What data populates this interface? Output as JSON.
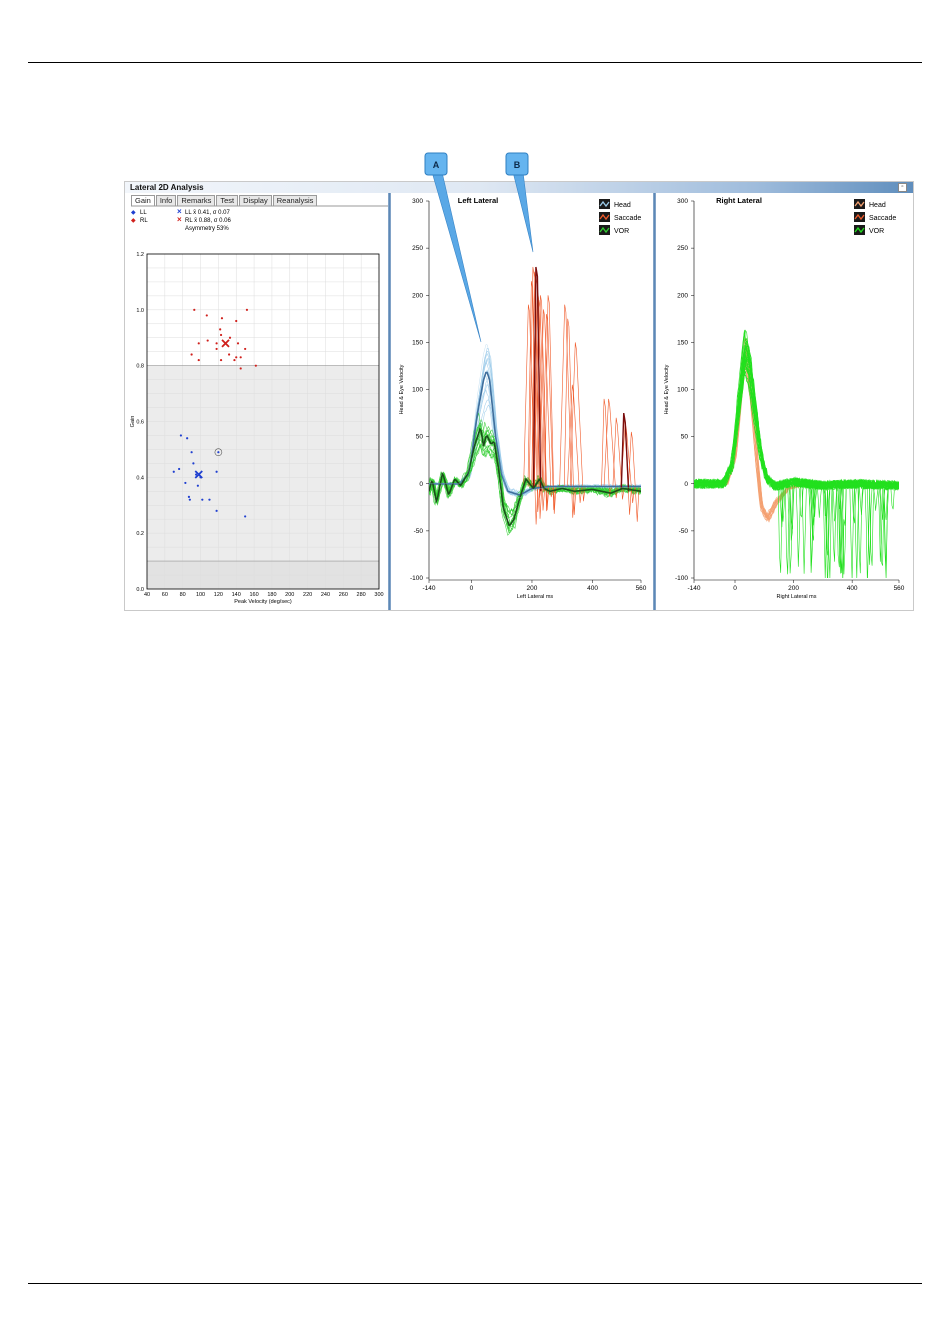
{
  "window": {
    "title": "Lateral 2D Analysis"
  },
  "tabs": [
    "Gain",
    "Info",
    "Remarks",
    "Test",
    "Display",
    "Reanalysis"
  ],
  "gain_panel": {
    "legend": [
      {
        "label": "LL",
        "color": "#1f3fd0"
      },
      {
        "label": "RL",
        "color": "#d0201c"
      }
    ],
    "stats": {
      "ll": "LL x̄ 0.41, σ 0.07",
      "rl": "RL x̄ 0.88, σ 0.06",
      "asymmetry": "Asymmetry 53%"
    }
  },
  "callouts": {
    "a": "A",
    "b": "B"
  },
  "chart_data": [
    {
      "type": "scatter",
      "xlabel": "Peak Velocity (deg/sec)",
      "ylabel": "Gain",
      "xlim": [
        40,
        300
      ],
      "ylim": [
        0,
        1.2
      ],
      "xticks": [
        40,
        60,
        80,
        100,
        120,
        140,
        160,
        180,
        200,
        220,
        240,
        260,
        280,
        300
      ],
      "yticks": [
        0.0,
        0.2,
        0.4,
        0.6,
        0.8,
        1.0,
        1.2
      ],
      "normal_band": [
        0.8,
        1.2
      ],
      "lower_band": [
        0.0,
        0.1
      ],
      "series": [
        {
          "name": "LL",
          "color": "#1f3fd0",
          "points": [
            [
              78,
              0.55
            ],
            [
              85,
              0.54
            ],
            [
              90,
              0.49
            ],
            [
              120,
              0.49
            ],
            [
              92,
              0.45
            ],
            [
              70,
              0.42
            ],
            [
              76,
              0.43
            ],
            [
              95,
              0.41
            ],
            [
              100,
              0.4
            ],
            [
              118,
              0.42
            ],
            [
              83,
              0.38
            ],
            [
              97,
              0.37
            ],
            [
              87,
              0.33
            ],
            [
              88,
              0.32
            ],
            [
              102,
              0.32
            ],
            [
              110,
              0.32
            ],
            [
              118,
              0.28
            ],
            [
              150,
              0.26
            ]
          ],
          "mean": [
            98,
            0.41
          ]
        },
        {
          "name": "RL",
          "color": "#d0201c",
          "points": [
            [
              93,
              1.0
            ],
            [
              107,
              0.98
            ],
            [
              152,
              1.0
            ],
            [
              124,
              0.97
            ],
            [
              140,
              0.96
            ],
            [
              122,
              0.93
            ],
            [
              123,
              0.91
            ],
            [
              133,
              0.9
            ],
            [
              108,
              0.89
            ],
            [
              98,
              0.88
            ],
            [
              142,
              0.88
            ],
            [
              118,
              0.86
            ],
            [
              150,
              0.86
            ],
            [
              90,
              0.84
            ],
            [
              132,
              0.84
            ],
            [
              140,
              0.83
            ],
            [
              145,
              0.83
            ],
            [
              98,
              0.82
            ],
            [
              123,
              0.82
            ],
            [
              138,
              0.82
            ],
            [
              162,
              0.8
            ],
            [
              145,
              0.79
            ],
            [
              118,
              0.88
            ]
          ],
          "mean": [
            128,
            0.88
          ]
        }
      ]
    },
    {
      "type": "line",
      "title": "Left Lateral",
      "xlabel": "Left Lateral ms",
      "ylabel": "Head & Eye Velocity",
      "xlim": [
        -140,
        560
      ],
      "ylim": [
        -100,
        300
      ],
      "xticks": [
        -140,
        0,
        200,
        400,
        560
      ],
      "yticks": [
        -100,
        -50,
        0,
        50,
        100,
        150,
        200,
        250,
        300
      ],
      "legend": [
        "Head",
        "Saccade",
        "VOR"
      ],
      "colors": {
        "head": "#9ccbea",
        "head_mean": "#3f6e9c",
        "saccade": "#f05a2a",
        "saccade_mean": "#7a0d0d",
        "vor": "#32cd32",
        "vor_mean": "#1b4f1b"
      },
      "head_mean": [
        [
          -140,
          0
        ],
        [
          -40,
          0
        ],
        [
          -10,
          10
        ],
        [
          0,
          28
        ],
        [
          20,
          75
        ],
        [
          40,
          110
        ],
        [
          50,
          120
        ],
        [
          60,
          110
        ],
        [
          80,
          50
        ],
        [
          100,
          10
        ],
        [
          120,
          -8
        ],
        [
          160,
          -12
        ],
        [
          200,
          -5
        ],
        [
          260,
          -3
        ],
        [
          560,
          -3
        ]
      ],
      "vor_mean": [
        [
          -140,
          -8
        ],
        [
          -130,
          5
        ],
        [
          -115,
          -20
        ],
        [
          -95,
          12
        ],
        [
          -75,
          -12
        ],
        [
          -55,
          5
        ],
        [
          -35,
          -2
        ],
        [
          -10,
          12
        ],
        [
          10,
          40
        ],
        [
          30,
          60
        ],
        [
          40,
          40
        ],
        [
          50,
          52
        ],
        [
          65,
          42
        ],
        [
          75,
          45
        ],
        [
          90,
          15
        ],
        [
          105,
          -25
        ],
        [
          125,
          -45
        ],
        [
          140,
          -38
        ],
        [
          160,
          -15
        ],
        [
          180,
          5
        ],
        [
          205,
          -5
        ],
        [
          225,
          5
        ],
        [
          240,
          -5
        ],
        [
          260,
          -8
        ],
        [
          300,
          -5
        ],
        [
          340,
          -8
        ],
        [
          400,
          -6
        ],
        [
          460,
          -10
        ],
        [
          500,
          -5
        ],
        [
          560,
          -8
        ]
      ],
      "saccade_mean_peaks": [
        [
          215,
          230
        ],
        [
          505,
          75
        ]
      ],
      "saccade_peaks": [
        [
          190,
          190
        ],
        [
          200,
          215
        ],
        [
          205,
          230
        ],
        [
          210,
          225
        ],
        [
          215,
          220
        ],
        [
          220,
          205
        ],
        [
          225,
          195
        ],
        [
          230,
          200
        ],
        [
          240,
          185
        ],
        [
          250,
          180
        ],
        [
          255,
          200
        ],
        [
          310,
          190
        ],
        [
          320,
          175
        ],
        [
          335,
          105
        ],
        [
          345,
          150
        ],
        [
          440,
          90
        ],
        [
          455,
          90
        ],
        [
          480,
          70
        ],
        [
          505,
          70
        ],
        [
          510,
          65
        ],
        [
          530,
          55
        ]
      ]
    },
    {
      "type": "line",
      "title": "Right Lateral",
      "xlabel": "Right Lateral ms",
      "ylabel": "Head & Eye Velocity",
      "xlim": [
        -140,
        560
      ],
      "ylim": [
        -100,
        300
      ],
      "xticks": [
        -140,
        0,
        200,
        400,
        560
      ],
      "yticks": [
        -100,
        -50,
        0,
        50,
        100,
        150,
        200,
        250,
        300
      ],
      "legend": [
        "Head",
        "Saccade",
        "VOR"
      ],
      "colors": {
        "head": "#f4a070",
        "saccade": "#f05a2a",
        "vor": "#22e01e"
      },
      "vor_mean": [
        [
          -140,
          0
        ],
        [
          -40,
          0
        ],
        [
          -10,
          20
        ],
        [
          10,
          75
        ],
        [
          25,
          120
        ],
        [
          35,
          148
        ],
        [
          50,
          130
        ],
        [
          70,
          80
        ],
        [
          90,
          30
        ],
        [
          110,
          5
        ],
        [
          140,
          -3
        ],
        [
          200,
          2
        ],
        [
          300,
          -2
        ],
        [
          400,
          0
        ],
        [
          560,
          -2
        ]
      ],
      "head_mean": [
        [
          -140,
          0
        ],
        [
          -30,
          0
        ],
        [
          0,
          30
        ],
        [
          20,
          100
        ],
        [
          35,
          148
        ],
        [
          55,
          100
        ],
        [
          75,
          20
        ],
        [
          90,
          -25
        ],
        [
          110,
          -38
        ],
        [
          140,
          -20
        ],
        [
          180,
          -5
        ],
        [
          240,
          0
        ],
        [
          560,
          0
        ]
      ]
    }
  ]
}
